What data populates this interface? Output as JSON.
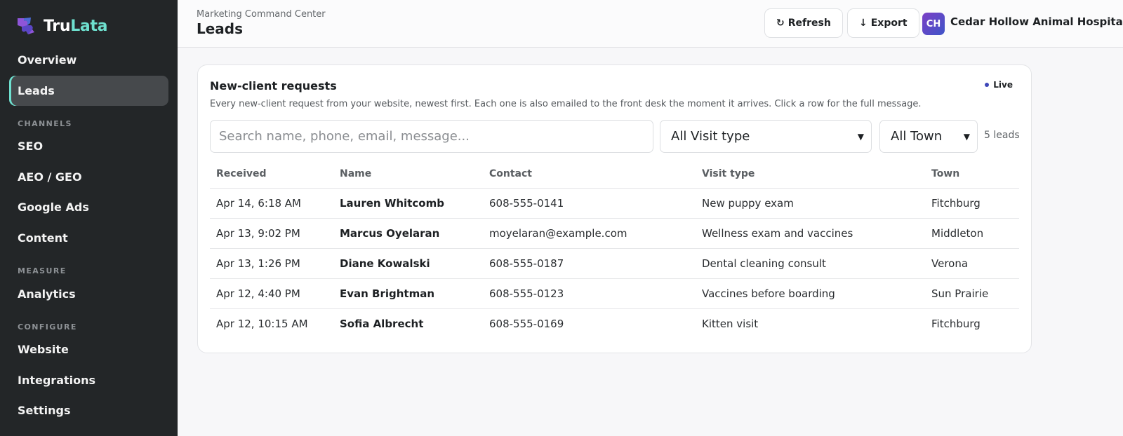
{
  "brand": {
    "part1": "Tru",
    "part2": "Lata"
  },
  "sidebar": {
    "items": [
      {
        "label": "Overview"
      },
      {
        "label": "Leads"
      },
      {
        "label": "SEO"
      },
      {
        "label": "AEO / GEO"
      },
      {
        "label": "Google Ads"
      },
      {
        "label": "Content"
      },
      {
        "label": "Analytics"
      },
      {
        "label": "Website"
      },
      {
        "label": "Integrations"
      },
      {
        "label": "Settings"
      }
    ],
    "sections": {
      "channels": "CHANNELS",
      "measure": "MEASURE",
      "configure": "CONFIGURE"
    }
  },
  "header": {
    "breadcrumb": "Marketing Command Center",
    "title": "Leads",
    "refresh_label": "Refresh",
    "export_label": "Export",
    "avatar_initials": "CH",
    "clinic_name": "Cedar Hollow Animal Hospital"
  },
  "card": {
    "title": "New-client requests",
    "description": "Every new-client request from your website, newest first. Each one is also emailed to the front desk the moment it arrives. Click a row for the full message.",
    "live_label": "Live",
    "search_placeholder": "Search name, phone, email, message...",
    "visit_filter": "All Visit type",
    "town_filter": "All Town",
    "count": "5 leads"
  },
  "table": {
    "headers": {
      "received": "Received",
      "name": "Name",
      "contact": "Contact",
      "visit": "Visit type",
      "town": "Town"
    },
    "rows": [
      {
        "received": "Apr 14, 6:18 AM",
        "name": "Lauren Whitcomb",
        "contact": "608-555-0141",
        "visit": "New puppy exam",
        "town": "Fitchburg"
      },
      {
        "received": "Apr 13, 9:02 PM",
        "name": "Marcus Oyelaran",
        "contact": "moyelaran@example.com",
        "visit": "Wellness exam and vaccines",
        "town": "Middleton"
      },
      {
        "received": "Apr 13, 1:26 PM",
        "name": "Diane Kowalski",
        "contact": "608-555-0187",
        "visit": "Dental cleaning consult",
        "town": "Verona"
      },
      {
        "received": "Apr 12, 4:40 PM",
        "name": "Evan Brightman",
        "contact": "608-555-0123",
        "visit": "Vaccines before boarding",
        "town": "Sun Prairie"
      },
      {
        "received": "Apr 12, 10:15 AM",
        "name": "Sofia Albrecht",
        "contact": "608-555-0169",
        "visit": "Kitten visit",
        "town": "Fitchburg"
      }
    ]
  },
  "icons": {
    "brand": "puzzle-logo-icon",
    "refresh": "refresh-icon",
    "export": "download-arrow-icon",
    "dropdown": "chevron-down-icon",
    "live": "live-dot-icon"
  },
  "colors": {
    "sidebar_bg": "#232628",
    "accent_teal": "#6ee0cf",
    "live_dot": "#3d46b8",
    "avatar_from": "#7b3fc6",
    "avatar_to": "#3f55c8"
  }
}
